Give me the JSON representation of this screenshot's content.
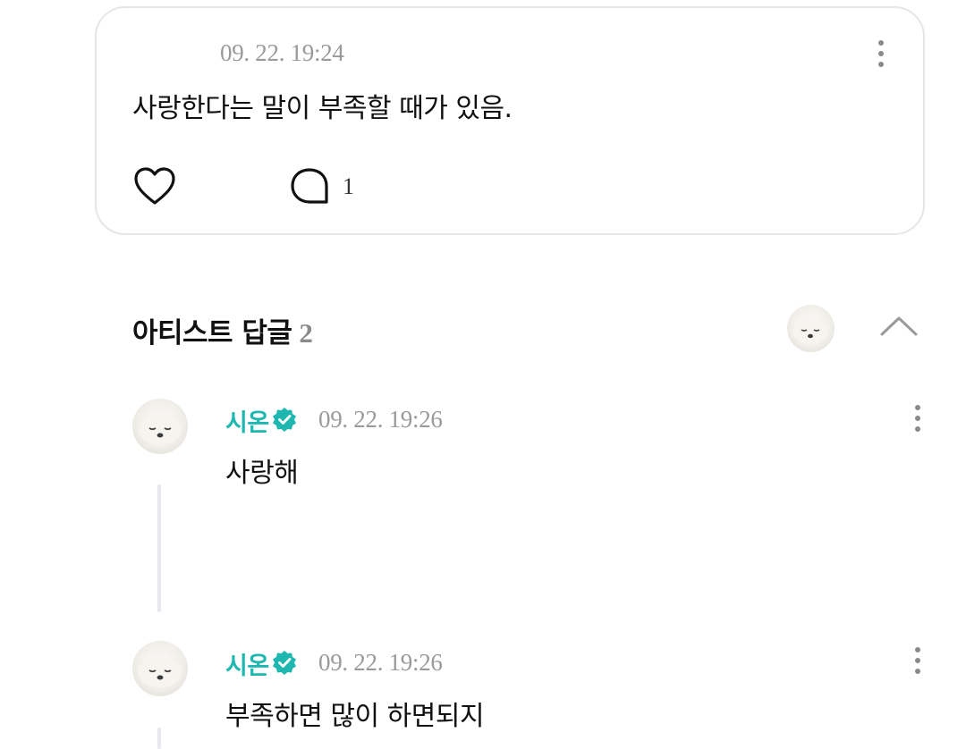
{
  "post": {
    "date": "09. 22. 19:24",
    "text": "사랑한다는 말이 부족할 때가 있음.",
    "comment_count": "1"
  },
  "replies": {
    "title": "아티스트 답글",
    "count": "2"
  },
  "comments": [
    {
      "author": "시온",
      "verified": true,
      "date": "09. 22. 19:26",
      "text": "사랑해"
    },
    {
      "author": "시온",
      "verified": true,
      "date": "09. 22. 19:26",
      "text": "부족하면 많이 하면되지"
    }
  ],
  "icons": {
    "like": "heart-outline-icon",
    "comment": "speech-bubble-icon",
    "more": "kebab-menu-icon",
    "collapse": "chevron-up-icon",
    "verified": "verified-badge-icon"
  },
  "colors": {
    "accent": "#1fb8b0",
    "muted_text": "#9a9a9a",
    "card_border": "#e6e6e6",
    "thread_line": "#e8e8ef"
  }
}
